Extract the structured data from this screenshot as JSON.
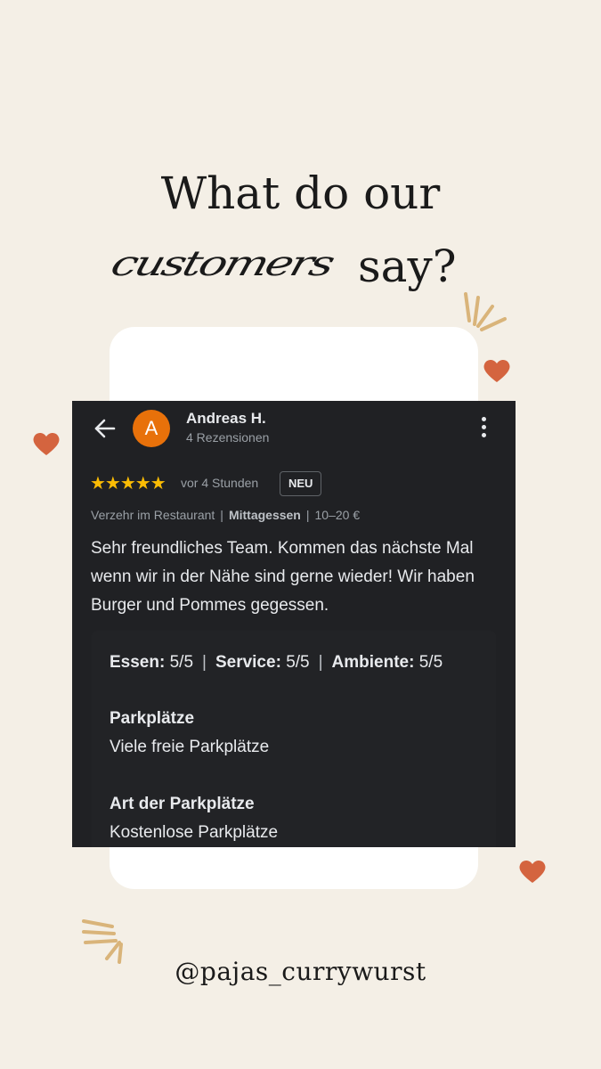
{
  "title": {
    "line1": "What do our",
    "script_word": "customers",
    "say": "say?"
  },
  "review": {
    "avatar_letter": "A",
    "name": "Andreas H.",
    "review_count": "4 Rezensionen",
    "stars": "★★★★★",
    "rating": 5,
    "time": "vor 4 Stunden",
    "badge": "NEU",
    "meta": {
      "visit": "Verzehr im Restaurant",
      "meal": "Mittagessen",
      "price": "10–20 €"
    },
    "text": "Sehr freundliches Team. Kommen das nächste Mal wenn wir in der Nähe sind gerne wieder! Wir haben Burger und Pommes gegessen.",
    "ratings": {
      "food_label": "Essen:",
      "food_value": "5/5",
      "service_label": "Service:",
      "service_value": "5/5",
      "ambience_label": "Ambiente:",
      "ambience_value": "5/5"
    },
    "parking_label": "Parkplätze",
    "parking_value": "Viele freie Parkplätze",
    "parking_type_label": "Art der Parkplätze",
    "parking_type_value": "Kostenlose Parkplätze"
  },
  "handle": "@pajas_currywurst",
  "colors": {
    "background": "#f4efe6",
    "card": "#ffffff",
    "review_bg": "#202124",
    "avatar": "#e8710a",
    "stars": "#fbbc04",
    "heart": "#d4643f",
    "sparkle": "#d9b47a"
  },
  "icons": [
    "back-arrow-icon",
    "more-vert-icon",
    "heart-icon",
    "sparkle-icon"
  ]
}
